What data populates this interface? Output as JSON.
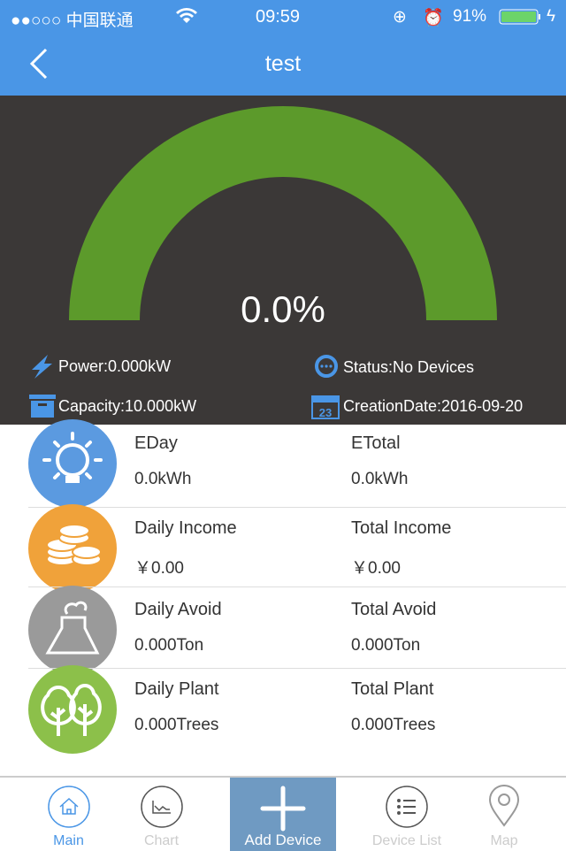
{
  "status_bar": {
    "carrier": "●●○○○ 中国联通",
    "time": "09:59",
    "battery": "91%"
  },
  "nav": {
    "title": "test",
    "back_icon": "chevron-left-icon"
  },
  "gauge": {
    "percent_label": "0.0%",
    "fill_percent": 100,
    "color": "#5c9a2b"
  },
  "info": {
    "power": "Power:0.000kW",
    "status": "Status:No Devices",
    "capacity": "Capacity:10.000kW",
    "creation": "CreationDate:2016-09-20"
  },
  "stats": [
    {
      "icon": "lightbulb-icon",
      "color": "#5b9ae0",
      "left_label": "EDay",
      "left_value": "0.0kWh",
      "right_label": "ETotal",
      "right_value": "0.0kWh"
    },
    {
      "icon": "coins-icon",
      "color": "#f0a23a",
      "left_label": "Daily Income",
      "left_value": "￥0.00",
      "right_label": "Total Income",
      "right_value": "￥0.00"
    },
    {
      "icon": "factory-smoke-icon",
      "color": "#9a9a9a",
      "left_label": "Daily Avoid",
      "left_value": "0.000Ton",
      "right_label": "Total Avoid",
      "right_value": "0.000Ton"
    },
    {
      "icon": "trees-icon",
      "color": "#8cc04a",
      "left_label": "Daily Plant",
      "left_value": "0.000Trees",
      "right_label": "Total Plant",
      "right_value": "0.000Trees"
    }
  ],
  "tabs": [
    {
      "label": "Main",
      "active": true
    },
    {
      "label": "Chart"
    },
    {
      "label": "Add Device"
    },
    {
      "label": "Device List"
    },
    {
      "label": "Map"
    }
  ]
}
